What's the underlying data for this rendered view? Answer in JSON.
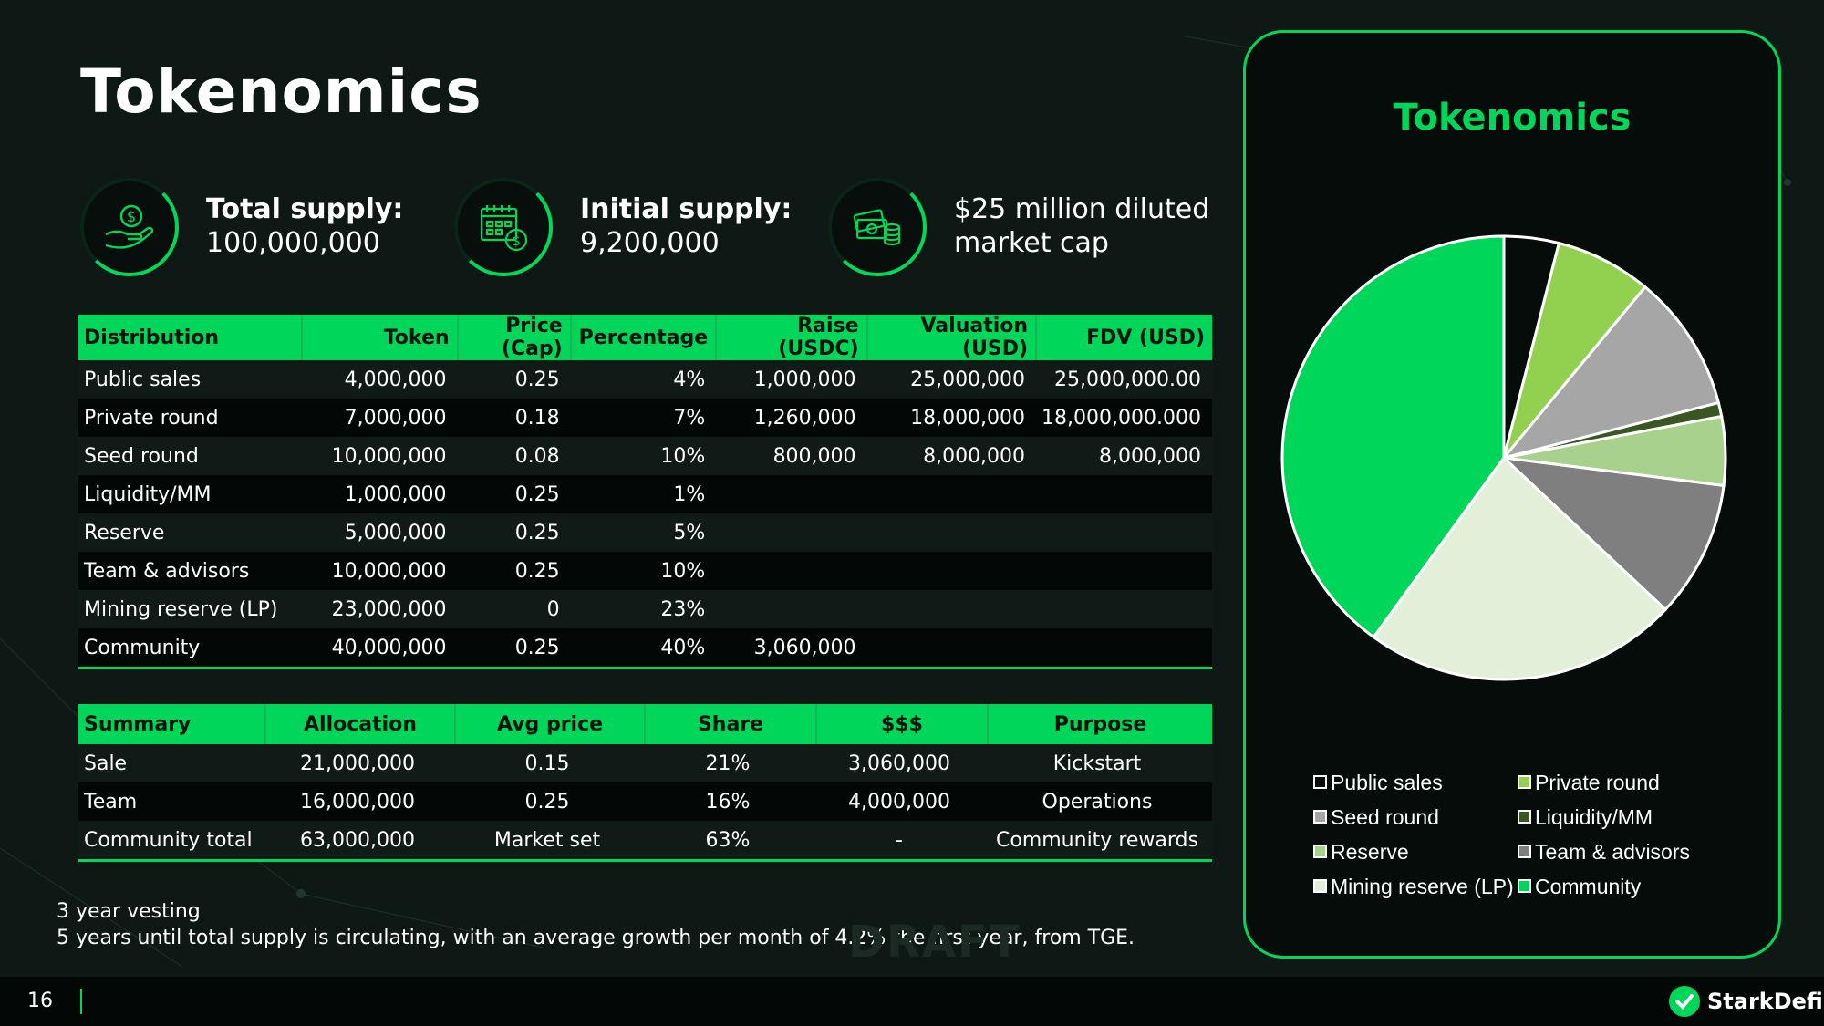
{
  "title": "Tokenomics",
  "stats": [
    {
      "label": "Total supply:",
      "value": "100,000,000",
      "icon": "hand-coin-icon"
    },
    {
      "label": "Initial supply:",
      "value": "9,200,000",
      "icon": "calendar-dollar-icon"
    },
    {
      "line1": "$25 million diluted",
      "line2": "market cap",
      "icon": "cash-stack-icon"
    }
  ],
  "distribution": {
    "headers": [
      "Distribution",
      "Token",
      "Price (Cap)",
      "Percentage",
      "Raise (USDC)",
      "Valuation (USD)",
      "FDV (USD)"
    ],
    "rows": [
      [
        "Public sales",
        "4,000,000",
        "0.25",
        "4%",
        "1,000,000",
        "25,000,000",
        "25,000,000.00"
      ],
      [
        "Private round",
        "7,000,000",
        "0.18",
        "7%",
        "1,260,000",
        "18,000,000",
        "18,000,000.000"
      ],
      [
        "Seed round",
        "10,000,000",
        "0.08",
        "10%",
        "800,000",
        "8,000,000",
        "8,000,000"
      ],
      [
        "Liquidity/MM",
        "1,000,000",
        "0.25",
        "1%",
        "",
        "",
        ""
      ],
      [
        "Reserve",
        "5,000,000",
        "0.25",
        "5%",
        "",
        "",
        ""
      ],
      [
        "Team & advisors",
        "10,000,000",
        "0.25",
        "10%",
        "",
        "",
        ""
      ],
      [
        "Mining reserve (LP)",
        "23,000,000",
        "0",
        "23%",
        "",
        "",
        ""
      ],
      [
        "Community",
        "40,000,000",
        "0.25",
        "40%",
        "3,060,000",
        "",
        ""
      ]
    ]
  },
  "summary": {
    "headers": [
      "Summary",
      "Allocation",
      "Avg price",
      "Share",
      "$$$",
      "Purpose"
    ],
    "rows": [
      [
        "Sale",
        "21,000,000",
        "0.15",
        "21%",
        "3,060,000",
        "Kickstart"
      ],
      [
        "Team",
        "16,000,000",
        "0.25",
        "16%",
        "4,000,000",
        "Operations"
      ],
      [
        "Community total",
        "63,000,000",
        "Market set",
        "63%",
        "-",
        "Community rewards"
      ]
    ]
  },
  "notes": {
    "line1": "3 year vesting",
    "line2": "5 years until total supply is circulating, with an average growth per month of 4.2% the first year, from TGE."
  },
  "watermark": "DRAFT",
  "footer": {
    "page_number": "16",
    "brand": "StarkDefi."
  },
  "colors": {
    "accent": "#00d659",
    "background": "#0e1915"
  },
  "chart_data": {
    "type": "pie",
    "title": "Tokenomics",
    "labels": [
      "Public sales",
      "Private round",
      "Seed round",
      "Liquidity/MM",
      "Reserve",
      "Team & advisors",
      "Mining reserve (LP)",
      "Community"
    ],
    "values": [
      4,
      7,
      10,
      1,
      5,
      10,
      23,
      40
    ],
    "colors": [
      "#050c09",
      "#92d050",
      "#a6a6a6",
      "#385723",
      "#a9d18e",
      "#7f7f7f",
      "#e2efd9",
      "#00d659"
    ],
    "legend_position": "bottom"
  }
}
